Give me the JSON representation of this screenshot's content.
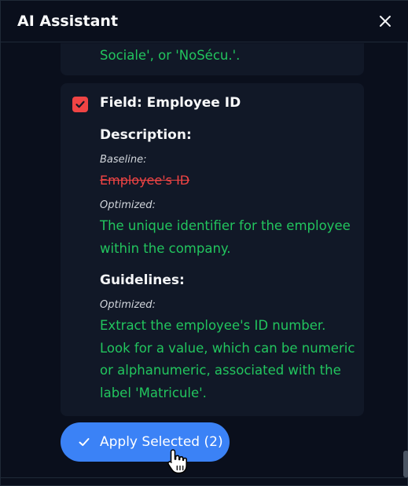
{
  "header": {
    "title": "AI Assistant",
    "close_icon": "close-icon"
  },
  "previous_card": {
    "text": "Sociale', or 'NoSécu.'."
  },
  "field_card": {
    "checked": true,
    "title": "Field: Employee ID",
    "description_heading": "Description:",
    "baseline_label": "Baseline:",
    "baseline_value": "Employee's ID",
    "optimized_label": "Optimized:",
    "optimized_description": "The unique identifier for the employee within the company.",
    "guidelines_heading": "Guidelines:",
    "guidelines_optimized_label": "Optimized:",
    "guidelines_optimized": "Extract the employee's ID number. Look for a value, which can be numeric or alphanumeric, associated with the label 'Matricule'."
  },
  "apply_button": {
    "label": "Apply Selected (2)",
    "icon": "check-icon"
  },
  "colors": {
    "background": "#0a0f1c",
    "card": "#111827",
    "accent_blue": "#3b82f6",
    "success_green": "#22c55e",
    "danger_red": "#ef4444"
  }
}
